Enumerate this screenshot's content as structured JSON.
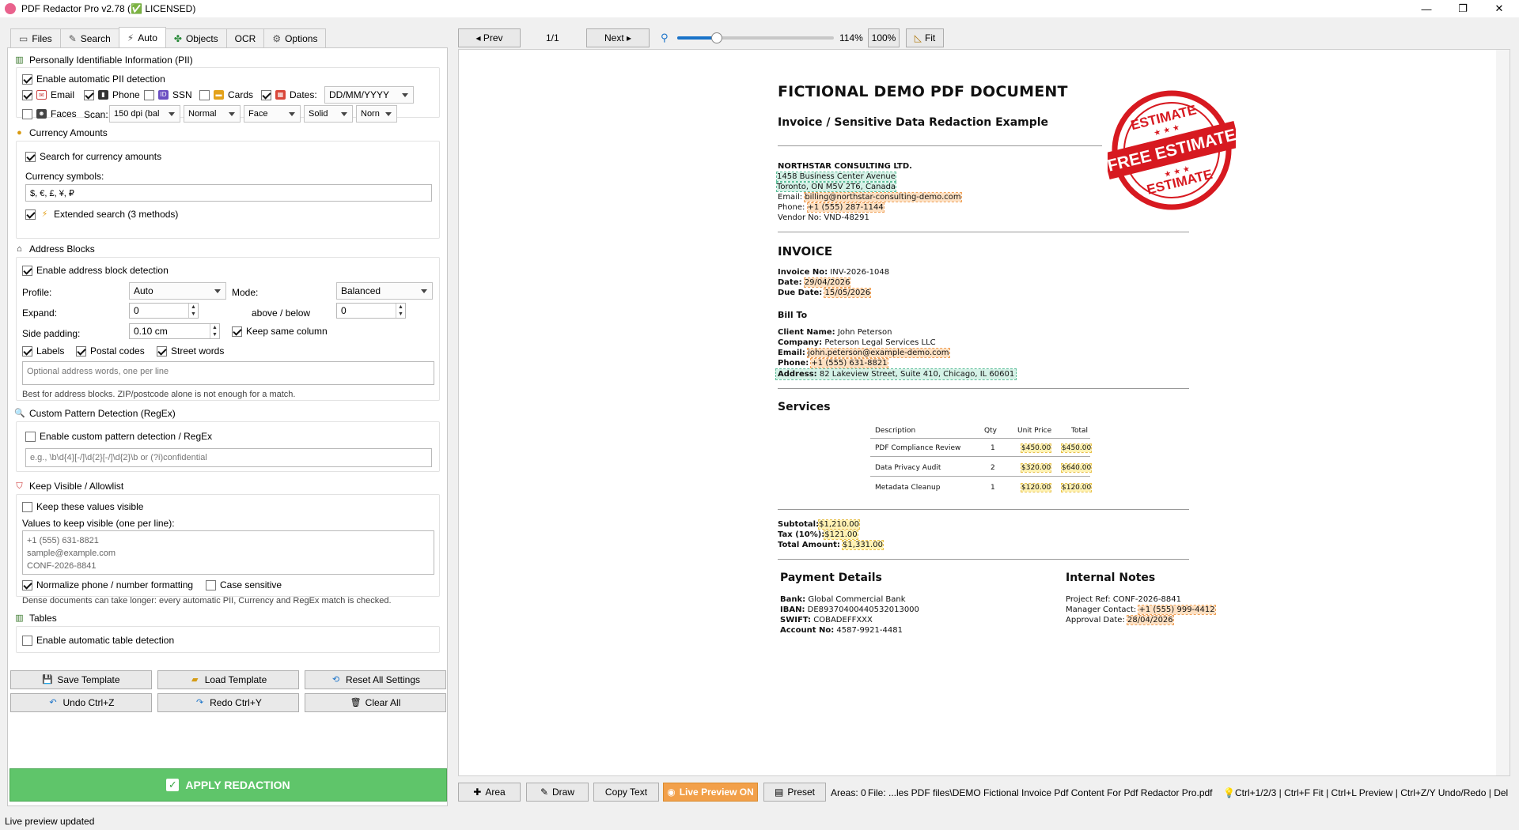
{
  "window": {
    "title": "PDF Redactor Pro v2.78 (✅ LICENSED)",
    "minimize": "—",
    "maximize": "❐",
    "close": "✕"
  },
  "tabs": [
    {
      "label": "Files",
      "icon": "folder-icon"
    },
    {
      "label": "Search",
      "icon": "pencil-icon"
    },
    {
      "label": "Auto",
      "icon": "lightning-icon"
    },
    {
      "label": "Objects",
      "icon": "puzzle-icon"
    },
    {
      "label": "OCR",
      "icon": ""
    },
    {
      "label": "Options",
      "icon": "gear-icon"
    }
  ],
  "pii": {
    "title": "Personally Identifiable Information (PII)",
    "enable": "Enable automatic PII detection",
    "email": "Email",
    "phone": "Phone",
    "ssn": "SSN",
    "cards": "Cards",
    "dates": "Dates:",
    "date_format": "DD/MM/YYYY",
    "faces": "Faces",
    "scan": "Scan:",
    "scan_value": "150 dpi (bal",
    "mode_value": "Normal",
    "target_value": "Face",
    "style_value": "Solid",
    "norm_value": "Norn"
  },
  "currency": {
    "title": "Currency Amounts",
    "search": "Search for currency amounts",
    "symbols_label": "Currency symbols:",
    "symbols_value": "$, €, £, ¥, ₽",
    "extended": "Extended search (3 methods)"
  },
  "address": {
    "title": "Address Blocks",
    "enable": "Enable address block detection",
    "profile_label": "Profile:",
    "profile_value": "Auto",
    "mode_label": "Mode:",
    "mode_value": "Balanced",
    "expand_label": "Expand:",
    "expand_value": "0",
    "above_below": "above / below",
    "above_value": "0",
    "side_padding_label": "Side padding:",
    "side_padding_value": "0.10 cm",
    "keep_column": "Keep same column",
    "labels": "Labels",
    "postal": "Postal codes",
    "street": "Street words",
    "optional_placeholder": "Optional address words, one per line",
    "hint": "Best for address blocks. ZIP/postcode alone is not enough for a match."
  },
  "regex": {
    "title": "Custom Pattern Detection (RegEx)",
    "enable": "Enable custom pattern detection / RegEx",
    "placeholder": "e.g.,  \\b\\d{4}[-/]\\d{2}[-/]\\d{2}\\b   or   (?i)confidential"
  },
  "allowlist": {
    "title": "Keep Visible / Allowlist",
    "keep": "Keep these values visible",
    "values_label": "Values to keep visible (one per line):",
    "values": [
      "+1 (555) 631-8821",
      "sample@example.com",
      "CONF-2026-8841"
    ],
    "normalize": "Normalize phone / number formatting",
    "case": "Case sensitive",
    "hint": "Dense documents can take longer: every automatic PII, Currency and RegEx match is checked."
  },
  "tables": {
    "title": "Tables",
    "enable": "Enable automatic table detection"
  },
  "buttons": {
    "save_template": "Save Template",
    "load_template": "Load Template",
    "reset": "Reset All Settings",
    "undo": "Undo  Ctrl+Z",
    "redo": "Redo  Ctrl+Y",
    "clear": "Clear All",
    "apply": "APPLY REDACTION"
  },
  "status": "Live preview updated",
  "viewer_toolbar": {
    "prev": "◂ Prev",
    "page": "1/1",
    "next": "Next ▸",
    "zoom": "114%",
    "zoom_fraction": 0.25,
    "hundred": "100%",
    "fit": "Fit"
  },
  "document": {
    "title": "FICTIONAL DEMO PDF DOCUMENT",
    "subtitle": "Invoice / Sensitive Data Redaction Example",
    "company": "NORTHSTAR CONSULTING LTD.",
    "addr1": "1458 Business Center Avenue",
    "addr2": "Toronto, ON M5V 2T6, Canada",
    "email_label": "Email:",
    "email": "billing@northstar-consulting-demo.com",
    "phone_label": "Phone:",
    "phone": "+1 (555) 287-1144",
    "vendor": "Vendor No: VND-48291",
    "invoice_heading": "INVOICE",
    "invoice_no_label": "Invoice No:",
    "invoice_no": "INV-2026-1048",
    "date_label": "Date:",
    "date": "29/04/2026",
    "due_label": "Due Date:",
    "due": "15/05/2026",
    "bill_to": "Bill To",
    "client_label": "Client Name:",
    "client": "John Peterson",
    "company_label": "Company:",
    "client_company": "Peterson Legal Services LLC",
    "client_email_label": "Email:",
    "client_email": "john.peterson@example-demo.com",
    "client_phone_label": "Phone:",
    "client_phone": "+1 (555) 631-8821",
    "client_addr_label": "Address:",
    "client_addr": "82 Lakeview Street, Suite 410, Chicago, IL 60601",
    "services": "Services",
    "cols": [
      "Description",
      "Qty",
      "Unit Price",
      "Total"
    ],
    "rows": [
      [
        "PDF Compliance Review",
        "1",
        "$450.00",
        "$450.00"
      ],
      [
        "Data Privacy Audit",
        "2",
        "$320.00",
        "$640.00"
      ],
      [
        "Metadata Cleanup",
        "1",
        "$120.00",
        "$120.00"
      ]
    ],
    "subtotal_label": "Subtotal:",
    "subtotal": "$1,210.00",
    "tax_label": "Tax (10%):",
    "tax": "$121.00",
    "total_label": "Total Amount:",
    "total": "$1,331.00",
    "payment": "Payment Details",
    "bank_label": "Bank:",
    "bank": "Global Commercial Bank",
    "iban_label": "IBAN:",
    "iban": "DE89370400440532013000",
    "swift_label": "SWIFT:",
    "swift": "COBADEFFXXX",
    "account_label": "Account No:",
    "account": "4587-9921-4481",
    "notes": "Internal Notes",
    "project_label": "Project Ref:",
    "project": "CONF-2026-8841",
    "manager_label": "Manager Contact:",
    "manager": "+1 (555) 999-4412",
    "approval_label": "Approval Date:",
    "approval": "28/04/2026",
    "stamp_top": "ESTIMATE",
    "stamp_mid": "FREE ESTIMATE",
    "stamp_bottom": "ESTIMATE"
  },
  "bottom": {
    "area": "Area",
    "draw": "Draw",
    "copy": "Copy Text",
    "live": "Live Preview ON",
    "preset": "Preset",
    "areas": "Areas: 0",
    "file": "File: ...les PDF files\\DEMO Fictional Invoice Pdf Content For Pdf Redactor Pro.pdf",
    "shortcuts": "Ctrl+1/2/3 | Ctrl+F Fit | Ctrl+L Preview | Ctrl+Z/Y Undo/Redo | Del"
  },
  "colors": {
    "accent": "#1a73c9",
    "apply": "#5fc56a",
    "orange": "#f2a04a",
    "stamp": "#d71920"
  }
}
